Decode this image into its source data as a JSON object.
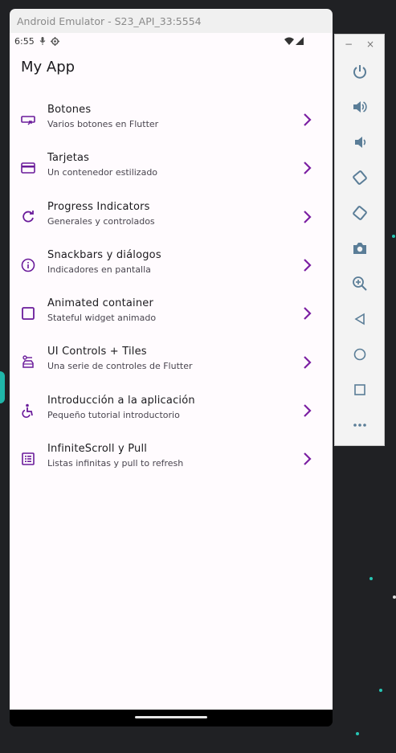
{
  "window": {
    "title": "Android Emulator - S23_API_33:5554"
  },
  "status_bar": {
    "time": "6:55"
  },
  "app": {
    "title": "My App"
  },
  "accent_color": "#7b1fa2",
  "menu": [
    {
      "title": "Botones",
      "subtitle": "Varios botones en Flutter",
      "icon": "input-icon"
    },
    {
      "title": "Tarjetas",
      "subtitle": "Un contenedor estilizado",
      "icon": "credit-card-icon"
    },
    {
      "title": "Progress Indicators",
      "subtitle": "Generales y controlados",
      "icon": "refresh-icon"
    },
    {
      "title": "Snackbars y diálogos",
      "subtitle": "Indicadores en pantalla",
      "icon": "info-icon"
    },
    {
      "title": "Animated container",
      "subtitle": "Stateful widget animado",
      "icon": "check-box-outline-icon"
    },
    {
      "title": "UI Controls + Tiles",
      "subtitle": "Una serie de controles de Flutter",
      "icon": "car-rental-icon"
    },
    {
      "title": "Introducción a la aplicación",
      "subtitle": "Pequeño tutorial introductorio",
      "icon": "accessible-icon"
    },
    {
      "title": "InfiniteScroll y Pull",
      "subtitle": "Listas infinitas y pull to refresh",
      "icon": "list-alt-icon"
    }
  ],
  "emulator_panel": {
    "minimize_glyph": "−",
    "close_glyph": "×"
  }
}
